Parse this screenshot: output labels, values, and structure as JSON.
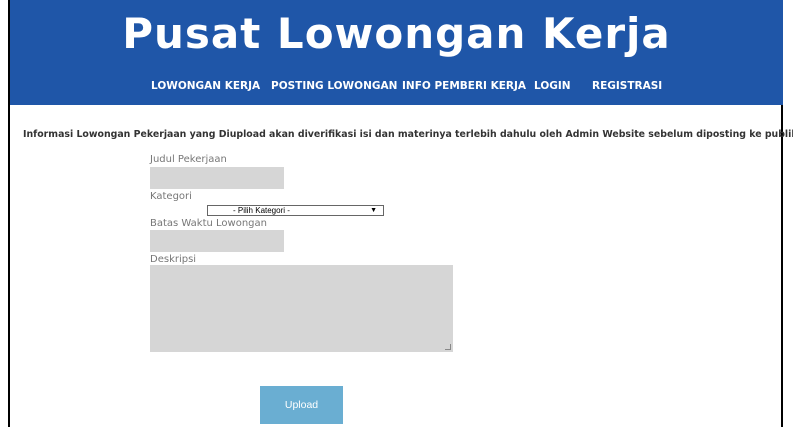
{
  "site_title": "Pusat Lowongan Kerja",
  "nav": [
    "LOWONGAN KERJA",
    "POSTING LOWONGAN",
    "INFO PEMBERI KERJA",
    "LOGIN",
    "REGISTRASI"
  ],
  "notice": "Informasi Lowongan Pekerjaan yang Diupload akan diverifikasi isi dan materinya terlebih dahulu oleh Admin Website sebelum diposting ke publik.",
  "form": {
    "judul_label": "Judul Pekerjaan",
    "kategori_label": "Kategori",
    "kategori_selected": "- Pilih Kategori -",
    "batas_label": "Batas Waktu Lowongan",
    "deskripsi_label": "Deskripsi",
    "upload_label": "Upload"
  },
  "colors": {
    "header": "#1f56a8",
    "input_bg": "#d6d6d6",
    "button": "#6aaed2"
  },
  "icons": {
    "select_arrow": "dropdown-arrow-icon"
  }
}
